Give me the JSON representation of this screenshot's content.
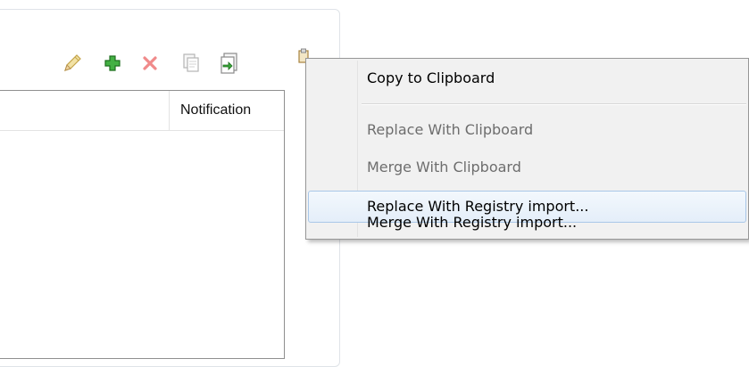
{
  "toolbar": {
    "buttons": [
      {
        "icon": "pencil-edit-icon",
        "color": "#c9a33a"
      },
      {
        "icon": "green-plus-add-icon",
        "color": "#2e9e2e"
      },
      {
        "icon": "red-x-delete-icon",
        "color": "#e25d5d"
      },
      {
        "icon": "copy-document-icon",
        "color": "#a5a5a5"
      },
      {
        "icon": "import-document-icon",
        "color": "#3a9b3a"
      },
      {
        "icon": "clipboard-icon",
        "color": "#b28a3a"
      }
    ]
  },
  "table": {
    "columns": [
      "",
      "Notification"
    ]
  },
  "context_menu": {
    "items": [
      {
        "label": "Copy to Clipboard",
        "enabled": true
      },
      {
        "label": "Replace With Clipboard",
        "enabled": false
      },
      {
        "label": "Merge With Clipboard",
        "enabled": false
      },
      {
        "label": "Replace With Registry import...",
        "enabled": true,
        "highlighted": true
      },
      {
        "label": "Merge With Registry import...",
        "enabled": true
      }
    ],
    "highlight_color": "#dceaf8",
    "highlight_border": "#a9c7e8"
  }
}
